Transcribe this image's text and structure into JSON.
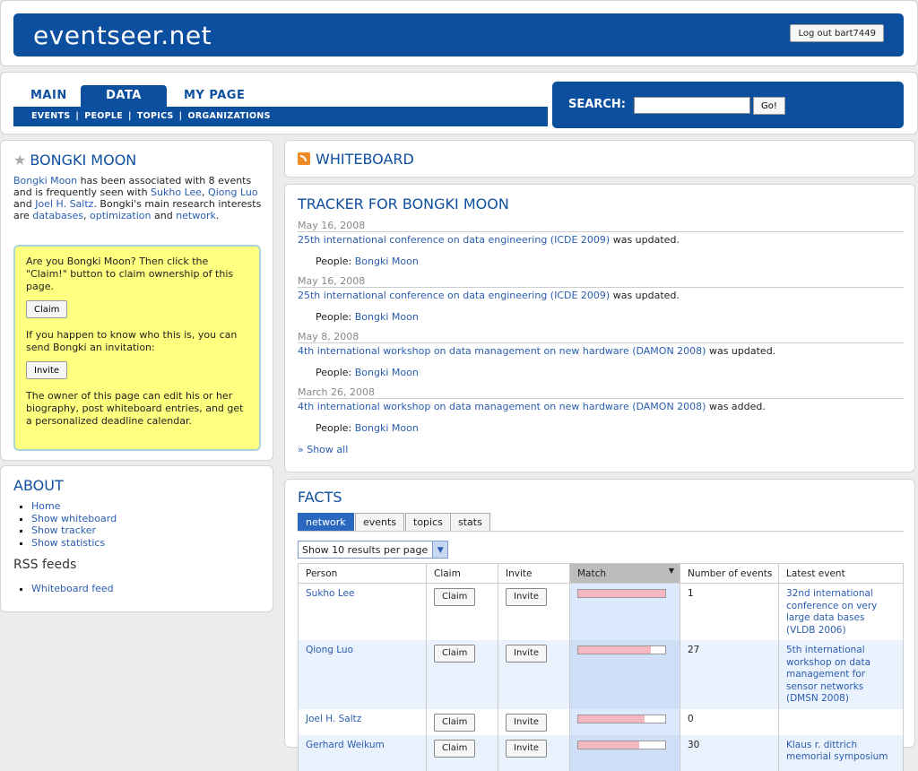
{
  "header": {
    "site_title": "eventseer.net",
    "logout_label": "Log out bart7449"
  },
  "nav": {
    "tabs": [
      "MAIN",
      "DATA",
      "MY PAGE"
    ],
    "subnav": [
      "EVENTS",
      "PEOPLE",
      "TOPICS",
      "ORGANIZATIONS"
    ],
    "subnav_sep": "|",
    "search_label": "SEARCH:",
    "search_value": "",
    "search_go": "Go!"
  },
  "profile": {
    "name": "BONGKI MOON",
    "bio": {
      "name_link": "Bongki Moon",
      "t1": " has been associated with 8 events and is frequently seen with ",
      "p1": "Sukho Lee",
      "c1": ", ",
      "p2": "Qiong Luo",
      "and1": " and ",
      "p3": "Joel H. Saltz",
      "t2": ". Bongki's main research interests are ",
      "i1": "databases",
      "c2": ", ",
      "i2": "optimization",
      "and2": " and ",
      "i3": "network",
      "end": "."
    },
    "claim_box": {
      "text1": "Are you Bongki Moon? Then click the \"Claim!\" button to claim ownership of this page.",
      "claim_label": "Claim",
      "text2": "If you happen to know who this is, you can send Bongki an invitation:",
      "invite_label": "Invite",
      "text3": "The owner of this page can edit his or her biography, post whiteboard entries, and get a personalized deadline calendar."
    }
  },
  "about": {
    "title": "ABOUT",
    "links": [
      "Home",
      "Show whiteboard",
      "Show tracker",
      "Show statistics"
    ],
    "rss_title": "RSS feeds",
    "rss_links": [
      "Whiteboard feed"
    ]
  },
  "whiteboard": {
    "title": "WHITEBOARD"
  },
  "tracker": {
    "title": "TRACKER FOR BONGKI MOON",
    "people_label": "People: ",
    "entries": [
      {
        "date": "May 16, 2008",
        "event": "25th international conference on data engineering (ICDE 2009)",
        "action": " was updated.",
        "person": "Bongki Moon"
      },
      {
        "date": "May 16, 2008",
        "event": "25th international conference on data engineering (ICDE 2009)",
        "action": " was updated.",
        "person": "Bongki Moon"
      },
      {
        "date": "May 8, 2008",
        "event": "4th international workshop on data management on new hardware (DAMON 2008)",
        "action": " was updated.",
        "person": "Bongki Moon"
      },
      {
        "date": "March 26, 2008",
        "event": "4th international workshop on data management on new hardware (DAMON 2008)",
        "action": " was added.",
        "person": "Bongki Moon"
      }
    ],
    "show_all": "» Show all"
  },
  "facts": {
    "title": "FACTS",
    "tabs": [
      "network",
      "events",
      "topics",
      "stats"
    ],
    "page_size": "Show 10 results per page",
    "columns": [
      "Person",
      "Claim",
      "Invite",
      "Match",
      "Number of events",
      "Latest event"
    ],
    "claim_label": "Claim",
    "invite_label": "Invite",
    "rows": [
      {
        "person": "Sukho Lee",
        "match": 1.0,
        "events": "1",
        "latest": "32nd international conference on very large data bases (VLDB 2006)"
      },
      {
        "person": "Qiong Luo",
        "match": 0.84,
        "events": "27",
        "latest": "5th international workshop on data management for sensor networks (DMSN 2008)"
      },
      {
        "person": "Joel H. Saltz",
        "match": 0.76,
        "events": "0",
        "latest": ""
      },
      {
        "person": "Gerhard Weikum",
        "match": 0.7,
        "events": "30",
        "latest": "Klaus r. dittrich memorial symposium"
      }
    ]
  },
  "colors": {
    "brand": "#0d4f9f",
    "link": "#2a5db0",
    "claim_bg": "#ffff80",
    "match_fill": "#f5b8c0"
  }
}
